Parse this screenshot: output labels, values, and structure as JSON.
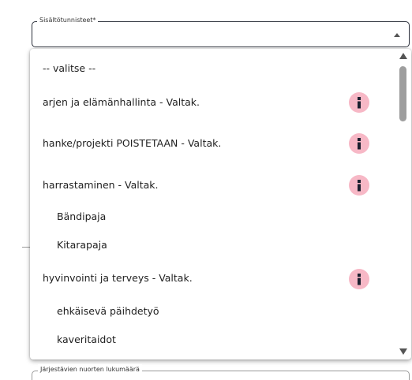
{
  "content_field": {
    "legend": "Sisältötunnisteet*",
    "value": ""
  },
  "dropdown": {
    "options": [
      {
        "label": "-- valitse --",
        "info": false,
        "sub": false
      },
      {
        "label": "arjen ja elämänhallinta - Valtak.",
        "info": true,
        "sub": false
      },
      {
        "label": "hanke/projekti POISTETAAN - Valtak.",
        "info": true,
        "sub": false
      },
      {
        "label": "harrastaminen - Valtak.",
        "info": true,
        "sub": false
      },
      {
        "label": "Bändipaja",
        "info": false,
        "sub": true
      },
      {
        "label": "Kitarapaja",
        "info": false,
        "sub": true
      },
      {
        "label": "hyvinvointi ja terveys - Valtak.",
        "info": true,
        "sub": false
      },
      {
        "label": "ehkäisevä päihdetyö",
        "info": false,
        "sub": true
      },
      {
        "label": "kaveritaidot",
        "info": false,
        "sub": true
      }
    ],
    "info_badge_color": "#f7b8c6",
    "info_icon": "info-icon"
  },
  "youth_count_field": {
    "legend": "Järjestävien nuorten lukumäärä"
  }
}
